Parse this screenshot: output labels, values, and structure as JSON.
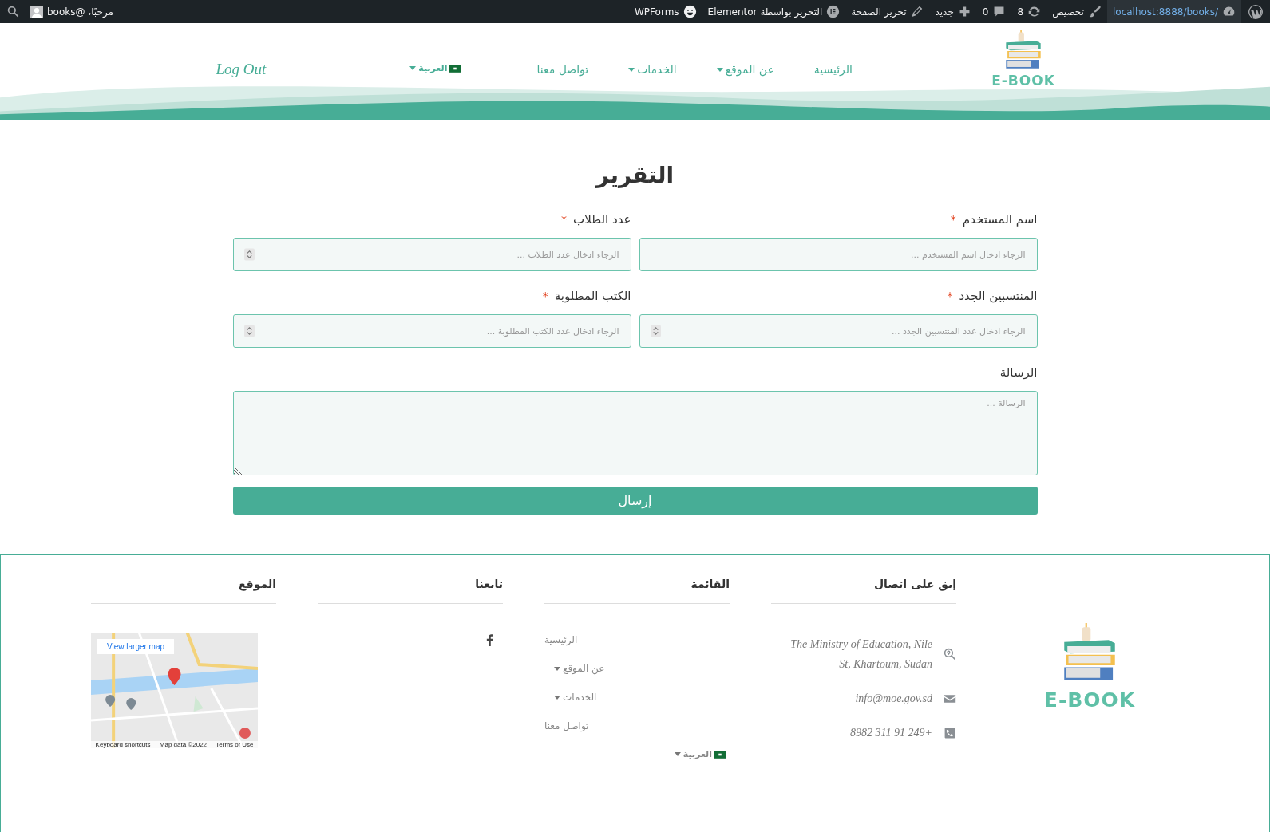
{
  "admin_bar": {
    "items": [
      {
        "kind": "site",
        "label": "/localhost:8888/books"
      },
      {
        "kind": "customize",
        "label": "تخصيص"
      },
      {
        "kind": "updates",
        "label": "8"
      },
      {
        "kind": "comments",
        "label": "0"
      },
      {
        "kind": "new",
        "label": "جديد"
      },
      {
        "kind": "edit",
        "label": "تحرير الصفحة"
      },
      {
        "kind": "elementor",
        "label": "التحرير بواسطة Elementor"
      },
      {
        "kind": "wpforms",
        "label": "WPForms"
      }
    ],
    "greeting": "مرحبًا، @books"
  },
  "header": {
    "logo_text": "E-BOOK",
    "nav": [
      {
        "label": "الرئيسية",
        "dropdown": false,
        "flag": false
      },
      {
        "label": "عن الموقع",
        "dropdown": true,
        "flag": false
      },
      {
        "label": "الخدمات",
        "dropdown": true,
        "flag": false
      },
      {
        "label": "تواصل معنا",
        "dropdown": false,
        "flag": false
      },
      {
        "label": "العربية",
        "dropdown": true,
        "flag": true
      }
    ],
    "logout": "Log Out"
  },
  "form": {
    "title": "التقرير",
    "fields": [
      {
        "kind": "text",
        "label": "اسم المستخدم",
        "required_mark": "*",
        "placeholder": "الرجاء ادخال اسم المستخدم ..."
      },
      {
        "kind": "number",
        "label": "عدد الطلاب",
        "required_mark": "*",
        "placeholder": "الرجاء ادخال عدد الطلاب ..."
      },
      {
        "kind": "number",
        "label": "المنتسبين الجدد",
        "required_mark": "*",
        "placeholder": "الرجاء ادخال عدد المنتسبين الجدد ..."
      },
      {
        "kind": "number",
        "label": "الكتب المطلوبة",
        "required_mark": "*",
        "placeholder": "الرجاء ادخال عدد الكتب المطلوبة ..."
      },
      {
        "kind": "textarea",
        "label": "الرسالة",
        "placeholder": "الرسالة ..."
      }
    ],
    "submit": "إرسال"
  },
  "footer": {
    "logo_text": "E-BOOK",
    "contact": {
      "title": "إبق على اتصال",
      "items": [
        {
          "kind": "address",
          "text": "The Ministry of Education, Nile St, Khartoum, Sudan"
        },
        {
          "kind": "email",
          "text": "info@moe.gov.sd"
        },
        {
          "kind": "phone",
          "text": "+249 91 311 8982"
        }
      ]
    },
    "menu": {
      "title": "القائمة",
      "items": [
        {
          "label": "الرئيسية",
          "dropdown": false,
          "flag": false
        },
        {
          "label": "عن الموقع",
          "dropdown": true,
          "flag": false
        },
        {
          "label": "الخدمات",
          "dropdown": true,
          "flag": false
        },
        {
          "label": "تواصل معنا",
          "dropdown": false,
          "flag": false
        },
        {
          "label": "العربية",
          "dropdown": true,
          "flag": true
        }
      ]
    },
    "follow": {
      "title": "تابعنا"
    },
    "location": {
      "title": "الموقع",
      "map": {
        "link": "View larger map",
        "shortcuts": "Keyboard shortcuts",
        "map_data": "Map data ©2022",
        "terms": "Terms of Use"
      }
    }
  }
}
